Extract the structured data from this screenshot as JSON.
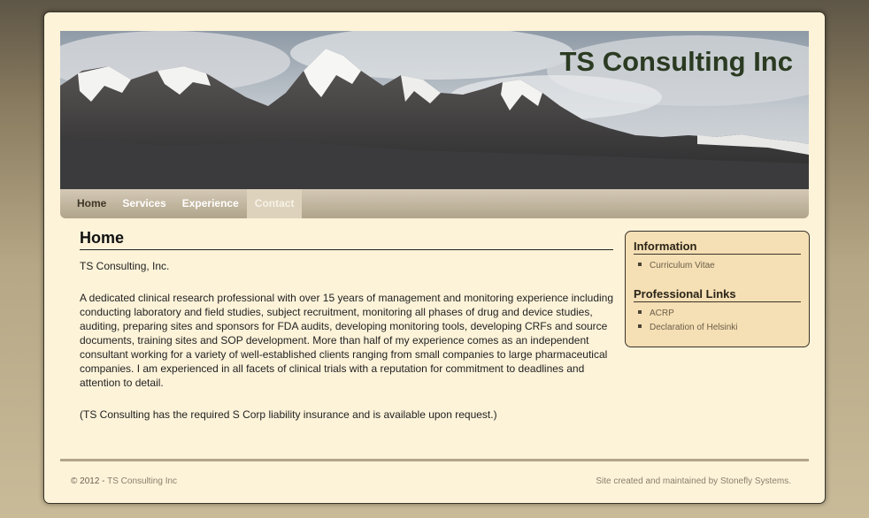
{
  "site": {
    "title": "TS Consulting Inc"
  },
  "nav": {
    "items": [
      {
        "label": "Home"
      },
      {
        "label": "Services"
      },
      {
        "label": "Experience"
      },
      {
        "label": "Contact"
      }
    ],
    "active": "Home",
    "highlighted": "Contact"
  },
  "main": {
    "heading": "Home",
    "intro": "TS Consulting, Inc.",
    "body": "A dedicated clinical research professional with over 15 years of management and monitoring experience including conducting laboratory and field studies, subject recruitment, monitoring all phases of drug and device studies, auditing, preparing sites and sponsors for FDA audits, developing monitoring tools, developing CRFs and source documents, training sites and SOP development.  More than half of my experience comes as an independent consultant working for a variety of well-established clients ranging from small companies to large pharmaceutical companies.  I am experienced in all facets of clinical trials with a reputation for commitment to deadlines and attention to detail.",
    "note": "(TS Consulting has the required S Corp liability insurance and is available upon request.)"
  },
  "sidebar": {
    "information": {
      "heading": "Information",
      "links": [
        "Curriculum Vitae"
      ]
    },
    "professional": {
      "heading": "Professional Links",
      "links": [
        "ACRP",
        "Declaration of Helsinki"
      ]
    }
  },
  "footer": {
    "copyright": "© 2012 - ",
    "company_link": "TS Consulting Inc",
    "credit": "Site created and maintained by Stonefly Systems."
  },
  "colors": {
    "page_background": "#fdf3d9",
    "sidebar_background": "#f5dfb4",
    "title_color": "#2b3b22",
    "nav_bar": "#b0a48b"
  },
  "icons": [
    "bullet-icon"
  ]
}
